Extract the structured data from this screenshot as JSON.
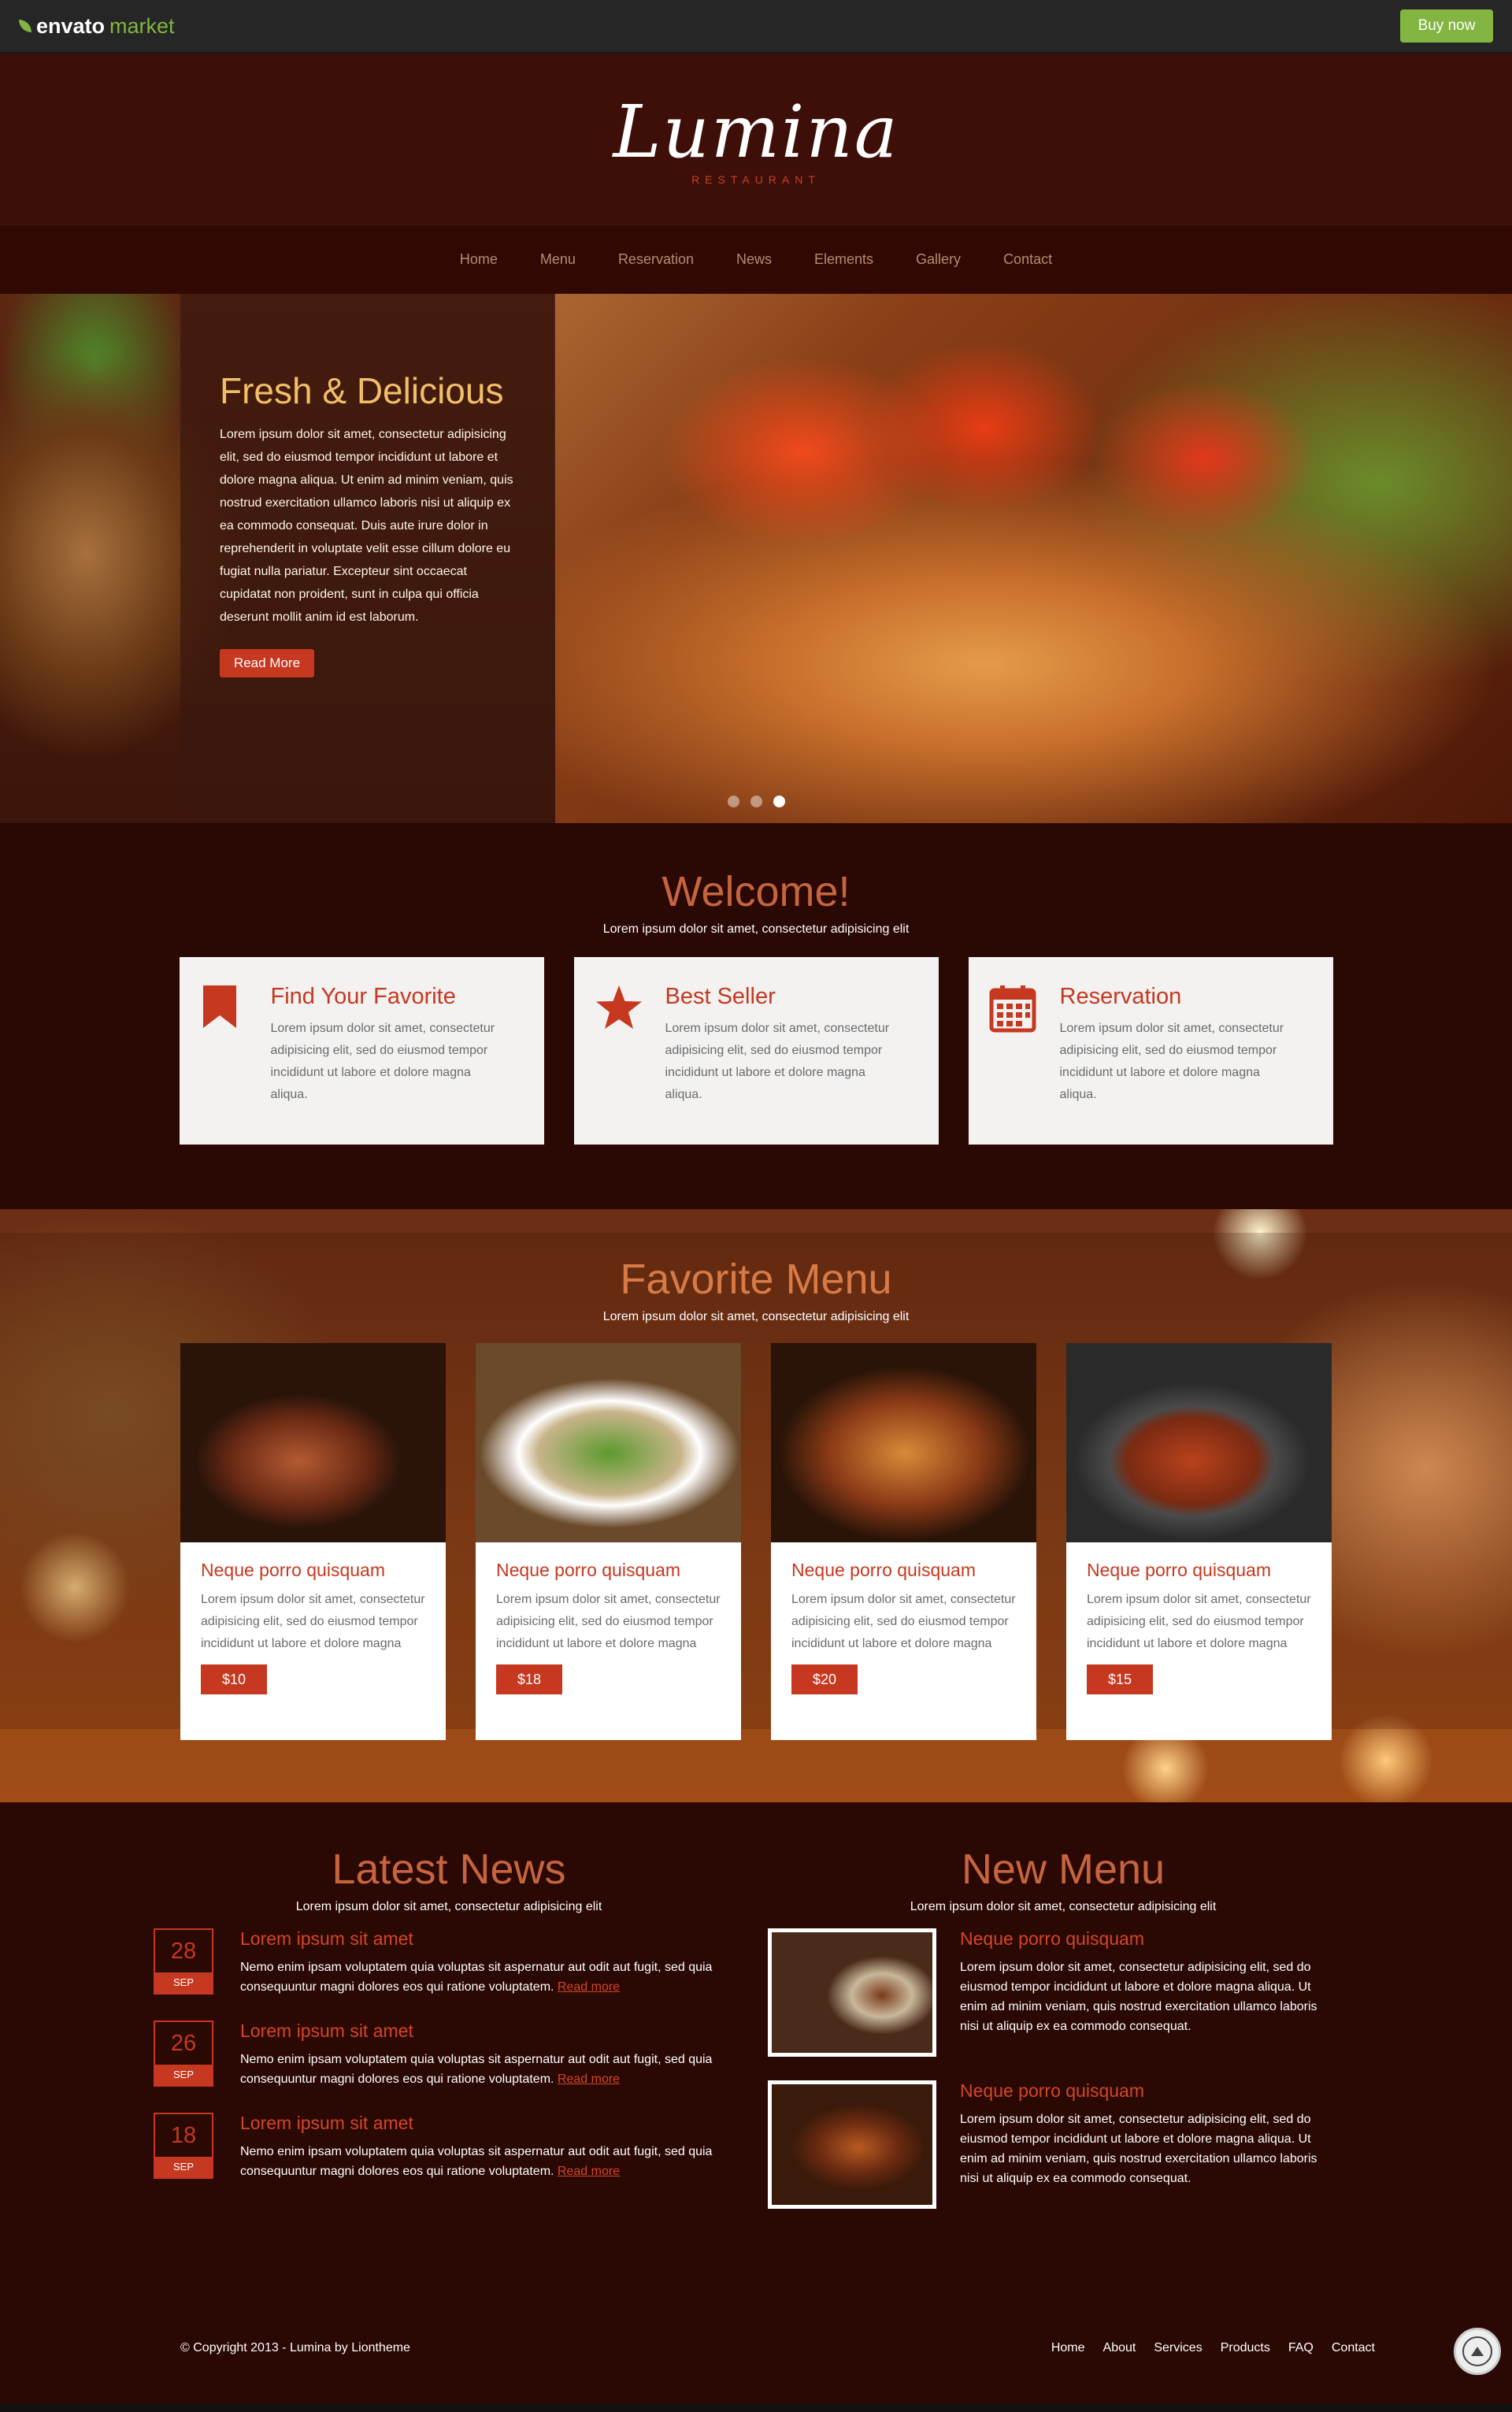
{
  "topbar": {
    "brand": "envato",
    "market": "market",
    "buy_label": "Buy now"
  },
  "header": {
    "logo": "Lumina",
    "logo_sub": "RESTAURANT"
  },
  "nav": {
    "items": [
      "Home",
      "Menu",
      "Reservation",
      "News",
      "Elements",
      "Gallery",
      "Contact"
    ]
  },
  "hero": {
    "title": "Fresh & Delicious",
    "text": "Lorem ipsum dolor sit amet, consectetur adipisicing elit, sed do eiusmod tempor incididunt ut labore et dolore magna aliqua. Ut enim ad minim veniam, quis nostrud exercitation ullamco laboris nisi ut aliquip ex ea commodo consequat. Duis aute irure dolor in reprehenderit in voluptate velit esse cillum dolore eu fugiat nulla pariatur. Excepteur sint occaecat cupidatat non proident, sunt in culpa qui officia deserunt mollit anim id est laborum.",
    "button": "Read More",
    "slides_active": 3
  },
  "welcome": {
    "title": "Welcome!",
    "subtitle": "Lorem ipsum dolor sit amet, consectetur adipisicing elit",
    "features": [
      {
        "icon": "bookmark-icon",
        "title": "Find Your Favorite",
        "text": "Lorem ipsum dolor sit amet, consectetur adipisicing elit, sed do eiusmod tempor incididunt ut labore et dolore magna aliqua."
      },
      {
        "icon": "star-icon",
        "title": "Best Seller",
        "text": "Lorem ipsum dolor sit amet, consectetur adipisicing elit, sed do eiusmod tempor incididunt ut labore et dolore magna aliqua."
      },
      {
        "icon": "calendar-icon",
        "title": "Reservation",
        "text": "Lorem ipsum dolor sit amet, consectetur adipisicing elit, sed do eiusmod tempor incididunt ut labore et dolore magna aliqua."
      }
    ]
  },
  "favorite": {
    "title": "Favorite Menu",
    "subtitle": "Lorem ipsum dolor sit amet, consectetur adipisicing elit",
    "items": [
      {
        "name": "Neque porro quisquam",
        "desc": "Lorem ipsum dolor sit amet, consectetur adipisicing elit, sed do eiusmod tempor incididunt ut labore et dolore magna",
        "price": "$10"
      },
      {
        "name": "Neque porro quisquam",
        "desc": "Lorem ipsum dolor sit amet, consectetur adipisicing elit, sed do eiusmod tempor incididunt ut labore et dolore magna",
        "price": "$18"
      },
      {
        "name": "Neque porro quisquam",
        "desc": "Lorem ipsum dolor sit amet, consectetur adipisicing elit, sed do eiusmod tempor incididunt ut labore et dolore magna",
        "price": "$20"
      },
      {
        "name": "Neque porro quisquam",
        "desc": "Lorem ipsum dolor sit amet, consectetur adipisicing elit, sed do eiusmod tempor incididunt ut labore et dolore magna",
        "price": "$15"
      }
    ]
  },
  "news": {
    "title": "Latest News",
    "subtitle": "Lorem ipsum dolor sit amet, consectetur adipisicing elit",
    "items": [
      {
        "day": "28",
        "month": "SEP",
        "title": "Lorem ipsum sit amet",
        "text": "Nemo enim ipsam voluptatem quia voluptas sit aspernatur aut odit aut fugit, sed quia consequuntur magni dolores eos qui ratione voluptatem.",
        "more": "Read more"
      },
      {
        "day": "26",
        "month": "SEP",
        "title": "Lorem ipsum sit amet",
        "text": "Nemo enim ipsam voluptatem quia voluptas sit aspernatur aut odit aut fugit, sed quia consequuntur magni dolores eos qui ratione voluptatem.",
        "more": "Read more"
      },
      {
        "day": "18",
        "month": "SEP",
        "title": "Lorem ipsum sit amet",
        "text": "Nemo enim ipsam voluptatem quia voluptas sit aspernatur aut odit aut fugit, sed quia consequuntur magni dolores eos qui ratione voluptatem.",
        "more": "Read more"
      }
    ]
  },
  "new_menu": {
    "title": "New Menu",
    "subtitle": "Lorem ipsum dolor sit amet, consectetur adipisicing elit",
    "items": [
      {
        "title": "Neque porro quisquam",
        "text": "Lorem ipsum dolor sit amet, consectetur adipisicing elit, sed do eiusmod tempor incididunt ut labore et dolore magna aliqua. Ut enim ad minim veniam, quis nostrud exercitation ullamco laboris nisi ut aliquip ex ea commodo consequat."
      },
      {
        "title": "Neque porro quisquam",
        "text": "Lorem ipsum dolor sit amet, consectetur adipisicing elit, sed do eiusmod tempor incididunt ut labore et dolore magna aliqua. Ut enim ad minim veniam, quis nostrud exercitation ullamco laboris nisi ut aliquip ex ea commodo consequat."
      }
    ]
  },
  "footer": {
    "copyright": "© Copyright 2013 - Lumina by Liontheme",
    "links": [
      "Home",
      "About",
      "Services",
      "Products",
      "FAQ",
      "Contact"
    ]
  },
  "colors": {
    "accent": "#c6381f",
    "background": "#2a0804",
    "envato_green": "#82b541"
  }
}
